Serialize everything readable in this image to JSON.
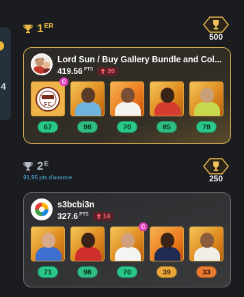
{
  "colors": {
    "gold": "#e9b84a",
    "first_border": "#e7b858",
    "trend_bg": "#5a2228",
    "trend_text": "#ff6473",
    "captain": "#e33fbd",
    "advance_text": "#4fb8e6"
  },
  "left_sliver": {
    "num": "4"
  },
  "entries": [
    {
      "rank": {
        "num": "1",
        "suffix": "ER",
        "icon": "trophy-icon"
      },
      "prize": {
        "amount": "500",
        "icon": "trophy-badge-icon"
      },
      "user": {
        "name": "Lord Sun / Buy Gallery Bundle and Col...",
        "score": "419.56",
        "score_unit": "PTS",
        "trend": "20",
        "trend_icon": "arrow-up-icon"
      },
      "players": [
        {
          "score": "67",
          "card": "club-crest"
        },
        {
          "score": "98",
          "card": "player-photo"
        },
        {
          "score": "70",
          "card": "player-photo"
        },
        {
          "score": "85",
          "card": "player-photo"
        },
        {
          "score": "78",
          "card": "player-photo"
        }
      ],
      "captain_badge": "C"
    },
    {
      "rank": {
        "num": "2",
        "suffix": "E",
        "icon": "trophy-icon"
      },
      "advance": "91,95 pts d'avance",
      "prize": {
        "amount": "250",
        "icon": "trophy-badge-icon"
      },
      "user": {
        "name": "s3bcbi3n",
        "score": "327.6",
        "score_unit": "PTS",
        "trend": "14",
        "trend_icon": "arrow-up-icon"
      },
      "players": [
        {
          "score": "71",
          "card": "player-photo"
        },
        {
          "score": "98",
          "card": "player-photo"
        },
        {
          "score": "70",
          "card": "player-photo"
        },
        {
          "score": "39",
          "card": "player-photo"
        },
        {
          "score": "33",
          "card": "player-photo"
        }
      ],
      "captain_badge": "C"
    }
  ]
}
